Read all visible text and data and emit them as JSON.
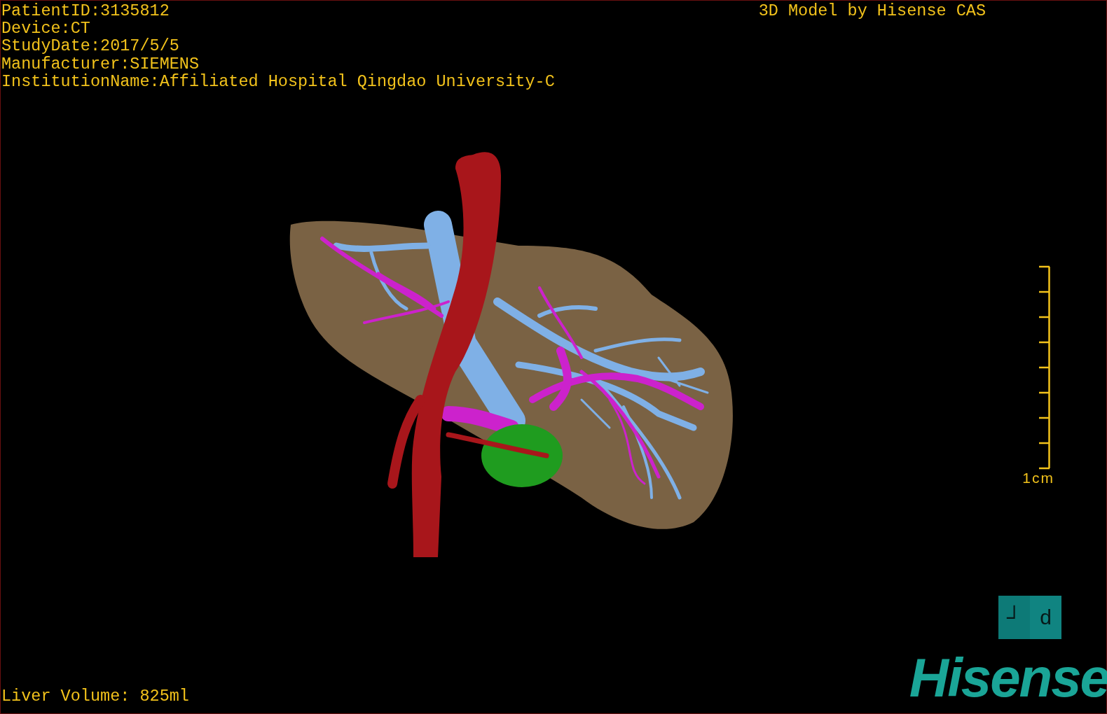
{
  "patient_info": [
    "PatientID:3135812",
    "Device:CT",
    "StudyDate:2017/5/5",
    "Manufacturer:SIEMENS",
    "InstitutionName:Affiliated Hospital Qingdao University-C"
  ],
  "title": "3D Model by Hisense CAS",
  "scale_bar": {
    "label": "1cm"
  },
  "orientation_cube": {
    "faces": [
      "┘",
      "d"
    ]
  },
  "liver_volume": "Liver Volume: 825ml",
  "logo": "Hisense"
}
